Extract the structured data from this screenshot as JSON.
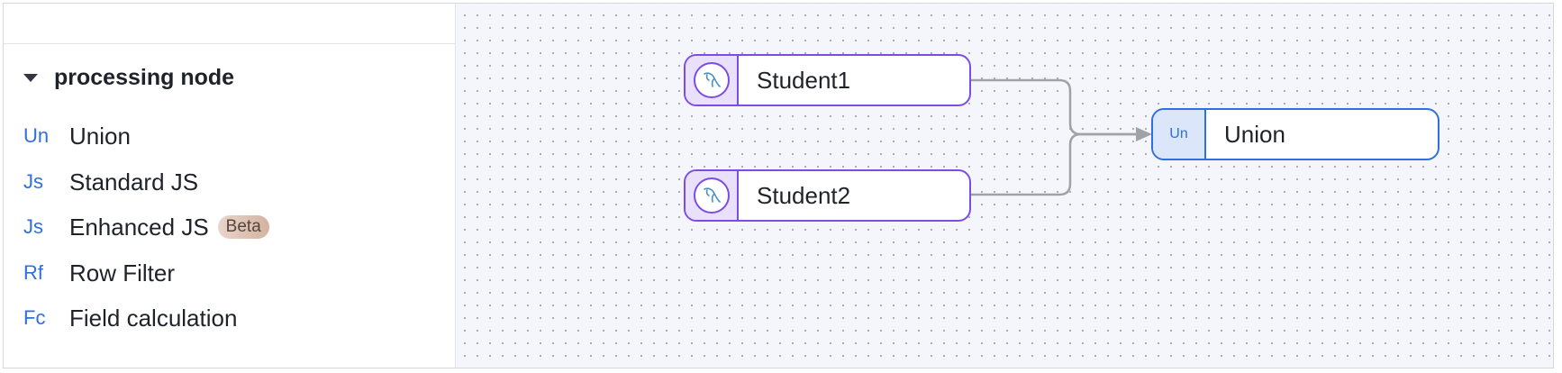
{
  "sidebar": {
    "section_title": "processing node",
    "items": [
      {
        "abbr": "Un",
        "label": "Union"
      },
      {
        "abbr": "Js",
        "label": "Standard JS"
      },
      {
        "abbr": "Js",
        "label": "Enhanced JS",
        "badge": "Beta"
      },
      {
        "abbr": "Rf",
        "label": "Row Filter"
      },
      {
        "abbr": "Fc",
        "label": "Field calculation"
      }
    ]
  },
  "canvas": {
    "nodes": [
      {
        "label": "Student1",
        "icon": "mysql-dolphin-icon",
        "kind": "source"
      },
      {
        "label": "Student2",
        "icon": "mysql-dolphin-icon",
        "kind": "source"
      },
      {
        "label": "Union",
        "abbr": "Un",
        "kind": "processor"
      }
    ],
    "edges": [
      {
        "from": "Student1",
        "to": "Union"
      },
      {
        "from": "Student2",
        "to": "Union"
      }
    ]
  },
  "colors": {
    "source_accent": "#7b4ce8",
    "processor_accent": "#2f6fe0",
    "beta_badge": "#d4b3a0"
  }
}
